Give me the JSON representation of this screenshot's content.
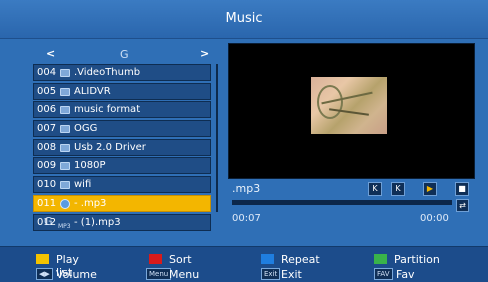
{
  "header": {
    "title": "Music"
  },
  "nav": {
    "left": "<",
    "drive": "G",
    "right": ">"
  },
  "files": [
    {
      "num": "004",
      "name": ".VideoThumb",
      "type": "folder"
    },
    {
      "num": "005",
      "name": "ALIDVR",
      "type": "folder"
    },
    {
      "num": "006",
      "name": "music format",
      "type": "folder"
    },
    {
      "num": "007",
      "name": "OGG",
      "type": "folder"
    },
    {
      "num": "008",
      "name": "Usb 2.0 Driver",
      "type": "folder"
    },
    {
      "num": "009",
      "name": "1080P",
      "type": "folder"
    },
    {
      "num": "010",
      "name": "wifi",
      "type": "folder"
    },
    {
      "num": "011",
      "name": " - .mp3",
      "type": "audio-selected"
    },
    {
      "num": "012",
      "name": " - (1).mp3",
      "type": "audio"
    }
  ],
  "drive_bottom": "G",
  "player": {
    "track": " .mp3",
    "buttons": {
      "prev": "K",
      "next": "K",
      "play": "▶",
      "stop": "■",
      "repeat": "⇄"
    },
    "elapsed": "00:07",
    "remaining": "00:00",
    "progress": 0
  },
  "footer": {
    "playlist": "Play list",
    "sort": "Sort",
    "repeat": "Repeat",
    "partition": "Partition",
    "volume": "Volume",
    "volume_chip": "◀▶",
    "menu": "Menu",
    "menu_chip": "Menu",
    "exit": "Exit",
    "exit_chip": "Exit",
    "fav": "Fav",
    "fav_chip": "FAV"
  },
  "colors": {
    "background": "#2f6fb6",
    "selected": "#f3b600",
    "yellow": "#f3c300",
    "red": "#d81b1b",
    "blue": "#1f7ee0",
    "green": "#39b34a"
  }
}
